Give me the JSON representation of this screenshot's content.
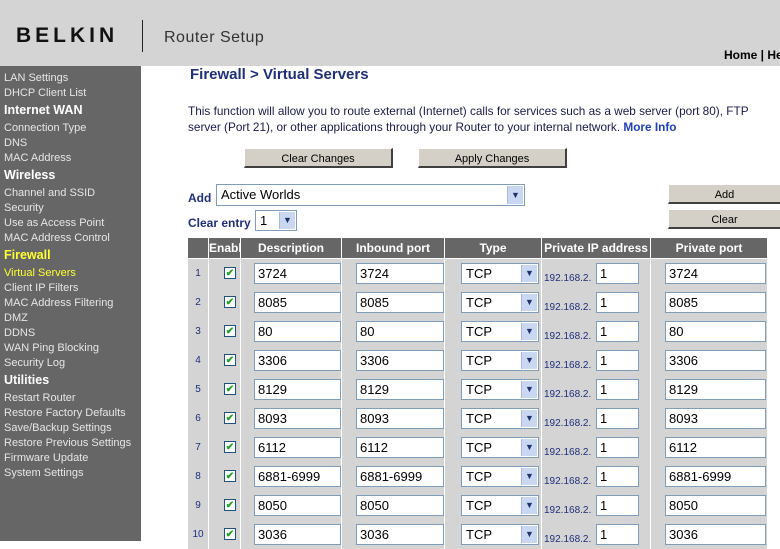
{
  "header": {
    "brand": "BELKIN",
    "app_title": "Router Setup",
    "links": [
      "Home",
      "He"
    ]
  },
  "sidebar": {
    "items": [
      {
        "label": "LAN Settings",
        "kind": "link"
      },
      {
        "label": "DHCP Client List",
        "kind": "link"
      },
      {
        "label": "Internet WAN",
        "kind": "heading"
      },
      {
        "label": "Connection Type",
        "kind": "link"
      },
      {
        "label": "DNS",
        "kind": "link"
      },
      {
        "label": "MAC Address",
        "kind": "link"
      },
      {
        "label": "Wireless",
        "kind": "heading"
      },
      {
        "label": "Channel and SSID",
        "kind": "link"
      },
      {
        "label": "Security",
        "kind": "link"
      },
      {
        "label": "Use as Access Point",
        "kind": "link"
      },
      {
        "label": "MAC Address Control",
        "kind": "link"
      },
      {
        "label": "Firewall",
        "kind": "heading-active"
      },
      {
        "label": "Virtual Servers",
        "kind": "link-active"
      },
      {
        "label": "Client IP Filters",
        "kind": "link"
      },
      {
        "label": "MAC Address Filtering",
        "kind": "link"
      },
      {
        "label": "DMZ",
        "kind": "link"
      },
      {
        "label": "DDNS",
        "kind": "link"
      },
      {
        "label": "WAN Ping Blocking",
        "kind": "link"
      },
      {
        "label": "Security Log",
        "kind": "link"
      },
      {
        "label": "Utilities",
        "kind": "heading"
      },
      {
        "label": "Restart Router",
        "kind": "link"
      },
      {
        "label": "Restore Factory Defaults",
        "kind": "link"
      },
      {
        "label": "Save/Backup Settings",
        "kind": "link"
      },
      {
        "label": "Restore Previous Settings",
        "kind": "link"
      },
      {
        "label": "Firmware Update",
        "kind": "link"
      },
      {
        "label": "System Settings",
        "kind": "link"
      }
    ]
  },
  "main": {
    "title": "Firewall > Virtual Servers",
    "intro": "This function will allow you to route external (Internet) calls for services such as a web server (port 80), FTP server (Port 21), or other applications through your Router to your internal network.",
    "more_info": "More Info",
    "clear_changes": "Clear Changes",
    "apply_changes": "Apply Changes",
    "add_label": "Add",
    "add_select_value": "Active Worlds",
    "add_button": "Add",
    "clear_entry_label": "Clear entry",
    "clear_entry_value": "1",
    "clear_button": "Clear"
  },
  "table": {
    "headers": [
      "Enable",
      "Description",
      "Inbound port",
      "Type",
      "Private IP address",
      "Private port"
    ],
    "ip_prefix": "192.168.2.",
    "rows": [
      {
        "num": "1",
        "enabled": true,
        "description": "3724",
        "inbound": "3724",
        "type": "TCP",
        "ip_last": "1",
        "private_port": "3724"
      },
      {
        "num": "2",
        "enabled": true,
        "description": "8085",
        "inbound": "8085",
        "type": "TCP",
        "ip_last": "1",
        "private_port": "8085"
      },
      {
        "num": "3",
        "enabled": true,
        "description": "80",
        "inbound": "80",
        "type": "TCP",
        "ip_last": "1",
        "private_port": "80"
      },
      {
        "num": "4",
        "enabled": true,
        "description": "3306",
        "inbound": "3306",
        "type": "TCP",
        "ip_last": "1",
        "private_port": "3306"
      },
      {
        "num": "5",
        "enabled": true,
        "description": "8129",
        "inbound": "8129",
        "type": "TCP",
        "ip_last": "1",
        "private_port": "8129"
      },
      {
        "num": "6",
        "enabled": true,
        "description": "8093",
        "inbound": "8093",
        "type": "TCP",
        "ip_last": "1",
        "private_port": "8093"
      },
      {
        "num": "7",
        "enabled": true,
        "description": "6112",
        "inbound": "6112",
        "type": "TCP",
        "ip_last": "1",
        "private_port": "6112"
      },
      {
        "num": "8",
        "enabled": true,
        "description": "6881-6999",
        "inbound": "6881-6999",
        "type": "TCP",
        "ip_last": "1",
        "private_port": "6881-6999"
      },
      {
        "num": "9",
        "enabled": true,
        "description": "8050",
        "inbound": "8050",
        "type": "TCP",
        "ip_last": "1",
        "private_port": "8050"
      },
      {
        "num": "10",
        "enabled": true,
        "description": "3036",
        "inbound": "3036",
        "type": "TCP",
        "ip_last": "1",
        "private_port": "3036"
      }
    ]
  },
  "colors": {
    "header_bg": "#d4d4d4",
    "sidebar_bg": "#666666",
    "active_yellow": "#ffff33",
    "title_blue": "#1f2f7a",
    "table_header_bg": "#666666",
    "cell_bg": "#d4d4d4"
  },
  "icons": {
    "dropdown": "chevron-down-icon",
    "checked": "checkmark-icon"
  }
}
